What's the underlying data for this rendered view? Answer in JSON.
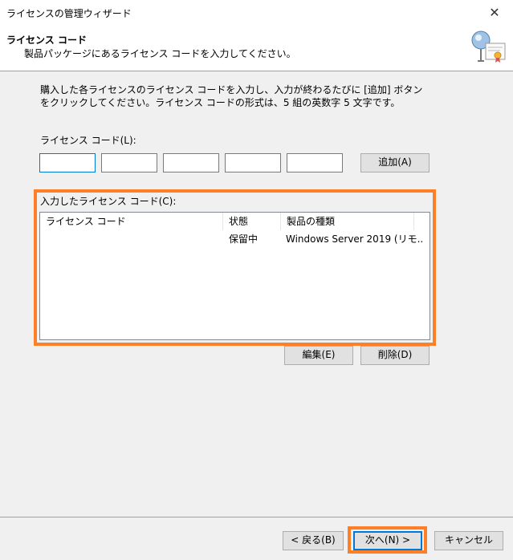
{
  "window": {
    "title": "ライセンスの管理ウィザード",
    "close_glyph": "✕"
  },
  "header": {
    "title": "ライセンス コード",
    "subtitle": "製品パッケージにあるライセンス コードを入力してください。",
    "icon": "certificate-icon"
  },
  "description": "購入した各ライセンスのライセンス コードを入力し、入力が終わるたびに [追加] ボタンをクリックしてください。ライセンス コードの形式は、5 組の英数字 5 文字です。",
  "license_code": {
    "label": "ライセンス コード(L):",
    "fields": [
      "",
      "",
      "",
      "",
      ""
    ],
    "add_label": "追加(A)"
  },
  "entered": {
    "label": "入力したライセンス コード(C):",
    "columns": [
      "ライセンス コード",
      "状態",
      "製品の種類"
    ],
    "rows": [
      {
        "code": "",
        "status": "保留中",
        "product": "Windows Server 2019 (リモ..."
      }
    ],
    "edit_label": "編集(E)",
    "delete_label": "削除(D)"
  },
  "footer": {
    "back_label": "< 戻る(B)",
    "next_label": "次へ(N) >",
    "cancel_label": "キャンセル"
  },
  "colors": {
    "highlight": "#ff7f27",
    "focus": "#0078d7"
  }
}
